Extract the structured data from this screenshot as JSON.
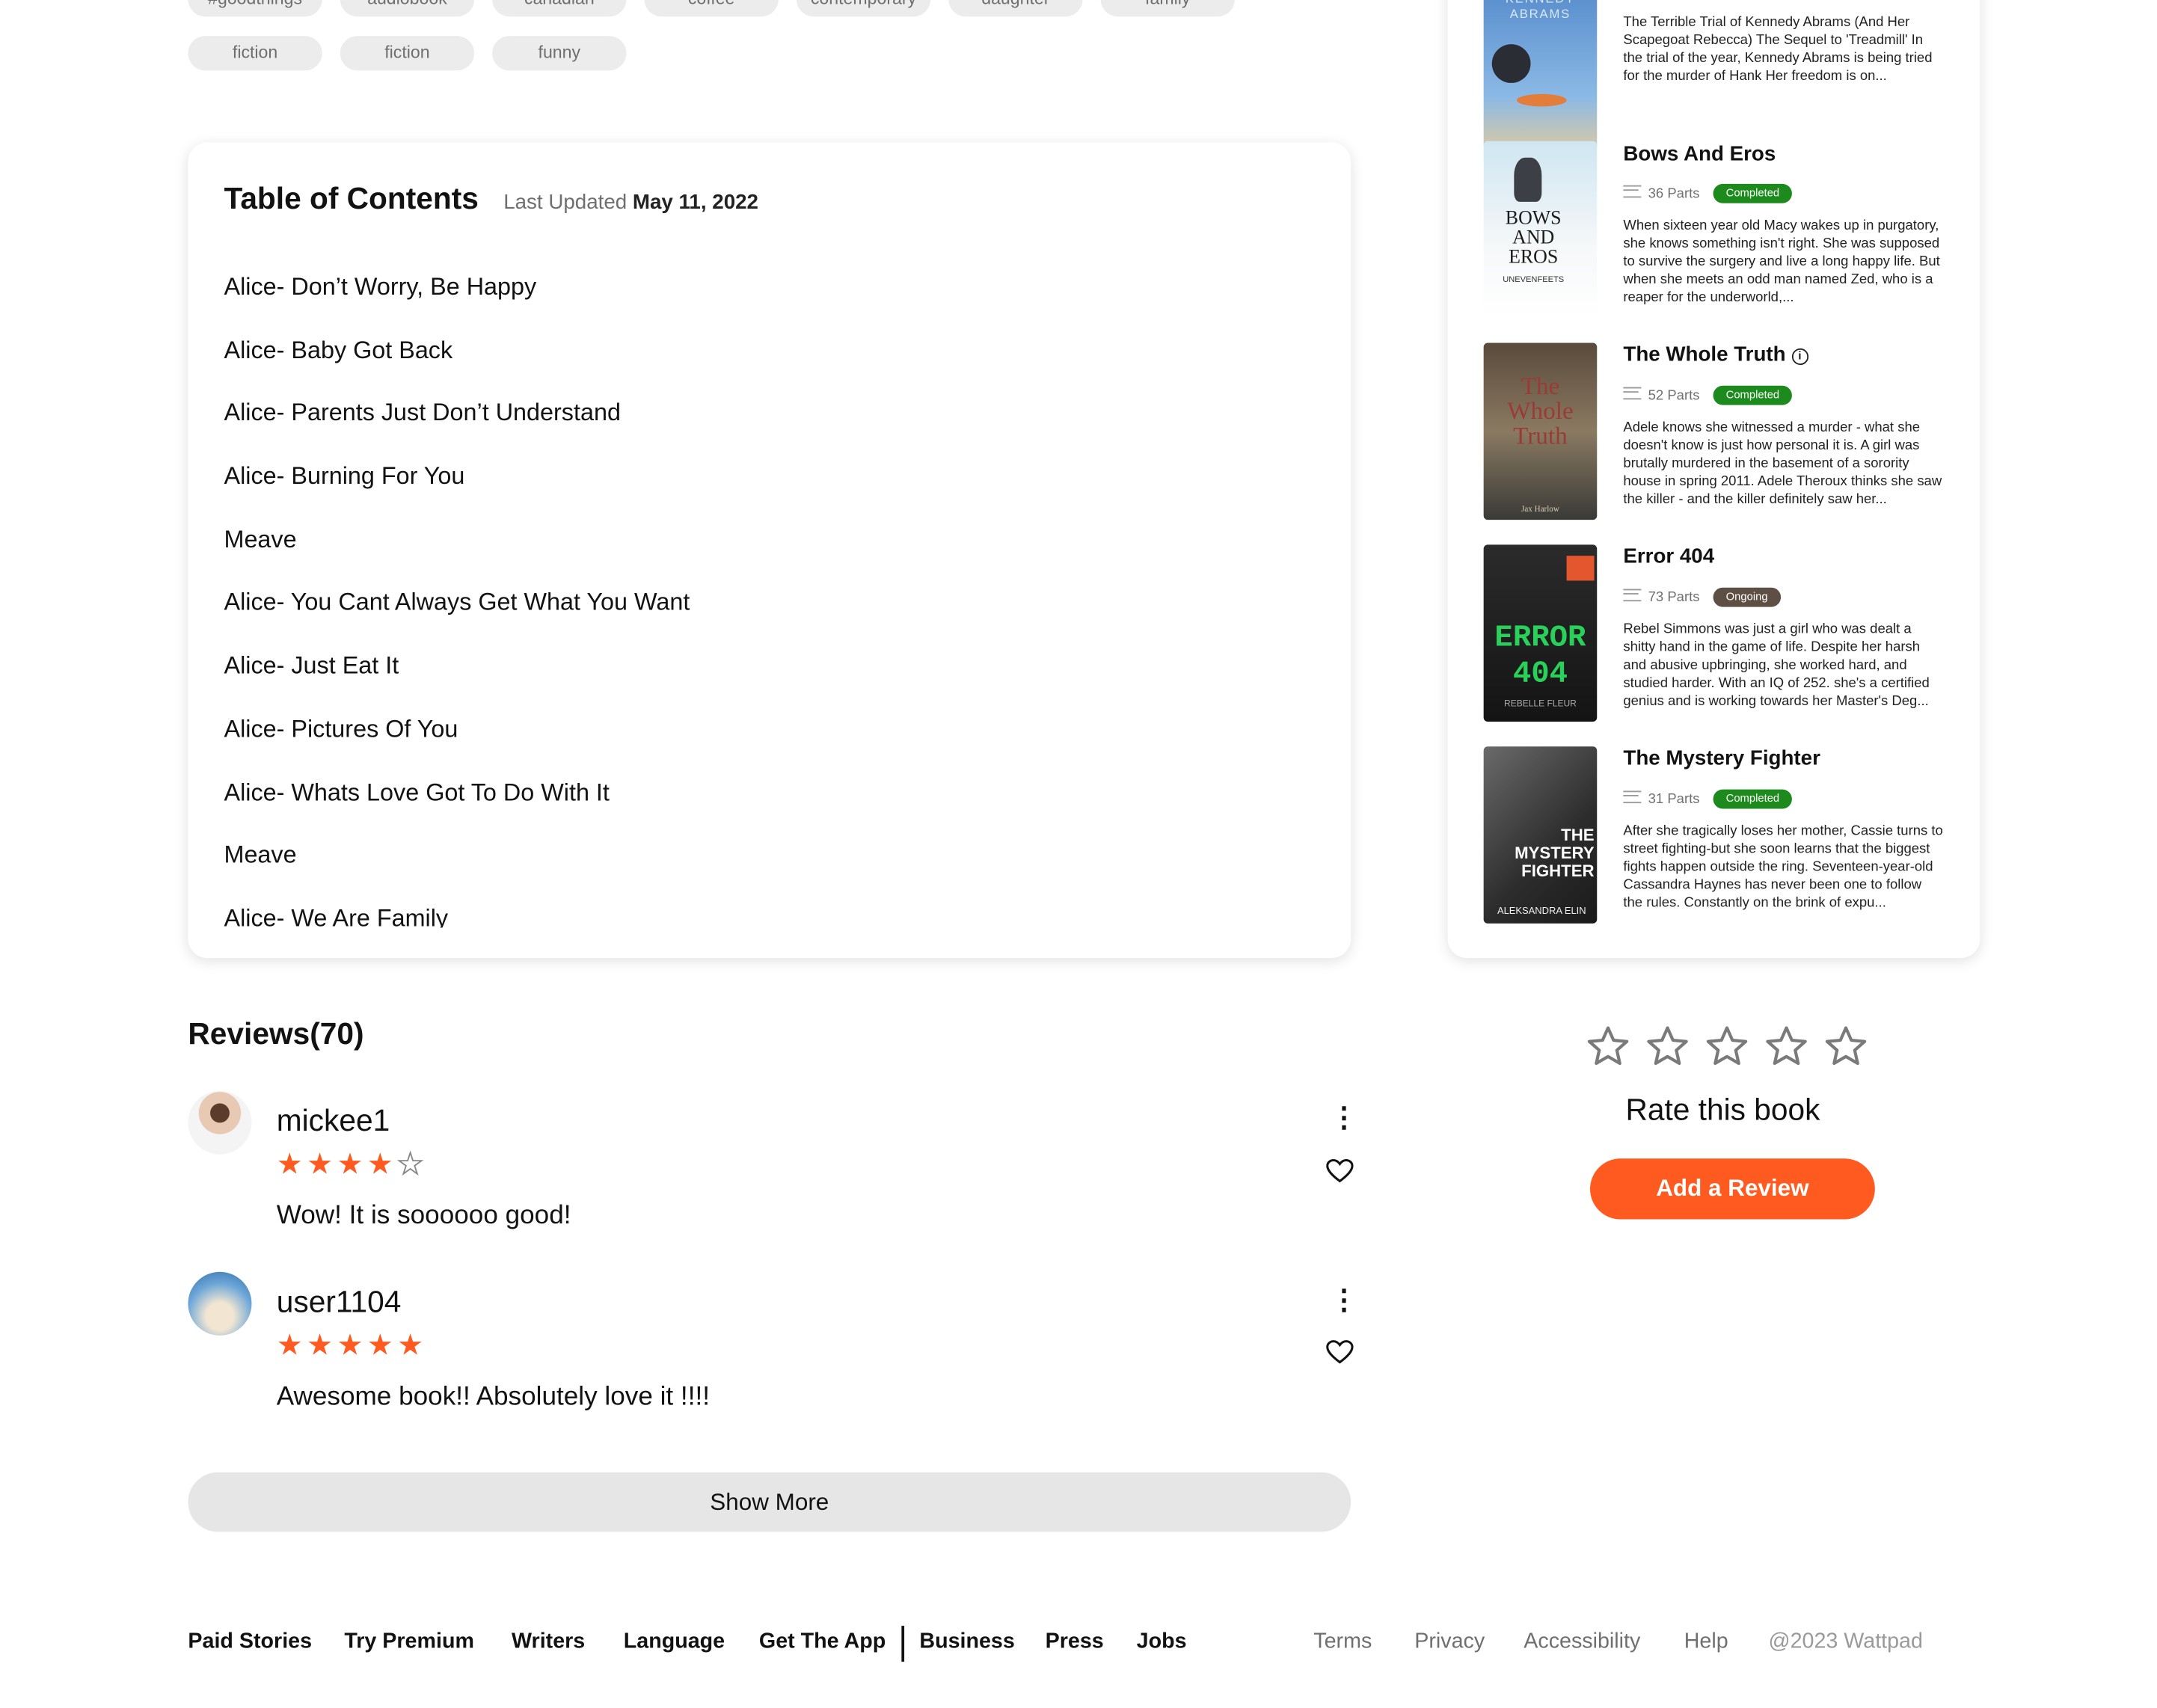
{
  "tags": {
    "row1": [
      "#goodthings",
      "audiobook",
      "canadian",
      "coffee",
      "contemporary",
      "daughter",
      "family"
    ],
    "row2": [
      "fiction",
      "fiction",
      "funny"
    ]
  },
  "toc": {
    "title": "Table of Contents",
    "last_updated_label": "Last Updated",
    "last_updated_date": "May 11, 2022",
    "chapters": [
      "Alice- Don’t Worry, Be Happy",
      "Alice- Baby Got Back",
      "Alice- Parents Just Don’t Understand",
      "Alice- Burning For You",
      "Meave",
      "Alice- You Cant Always Get What You Want",
      "Alice- Just Eat It",
      "Alice- Pictures Of You",
      "Alice- Whats Love Got To Do With It",
      "Meave",
      "Alice- We Are Family"
    ]
  },
  "recommendations": [
    {
      "cover_text": "KENNEDY ABRAMS",
      "description": "The Terrible Trial of Kennedy Abrams (And Her Scapegoat Rebecca) The Sequel to 'Treadmill' In the trial of the year, Kennedy Abrams is being tried for the murder of Hank Her freedom is on..."
    },
    {
      "title": "Bows And Eros",
      "parts": "36 Parts",
      "status": "Completed",
      "cover_text": "BOWS AND EROS",
      "cover_author": "UNEVENFEETS",
      "description": "When sixteen year old Macy wakes up in purgatory, she knows something isn't right. She was supposed to survive the surgery and live a long happy life. But when she meets an odd man named Zed, who is a reaper for the underworld,..."
    },
    {
      "title": "The Whole Truth",
      "parts": "52 Parts",
      "status": "Completed",
      "cover_text": "The Whole Truth",
      "cover_author": "Jax Harlow",
      "description": "Adele knows she witnessed a murder - what she doesn't know is just how personal it is. A girl was brutally murdered in the basement of a sorority house in spring 2011. Adele Theroux thinks she saw the killer - and the killer definitely saw her..."
    },
    {
      "title": "Error 404",
      "parts": "73 Parts",
      "status": "Ongoing",
      "cover_text": "ERROR 404",
      "cover_author": "REBELLE FLEUR",
      "description": "Rebel Simmons was just a girl who was dealt a shitty hand in the game of life. Despite her harsh and abusive upbringing, she worked hard, and studied harder. With an IQ of 252. she's a certified genius and is working towards her Master's Deg..."
    },
    {
      "title": "The Mystery Fighter",
      "parts": "31 Parts",
      "status": "Completed",
      "cover_text": "THE MYSTERY FIGHTER",
      "cover_author": "ALEKSANDRA ELIN",
      "description": "After she tragically loses her mother, Cassie turns to street fighting-but she soon learns that the biggest fights happen outside the ring. Seventeen-year-old Cassandra Haynes has never been one to follow the rules. Constantly on the brink of expu..."
    }
  ],
  "reviews": {
    "title": "Reviews(70)",
    "items": [
      {
        "user": "mickee1",
        "rating": 4,
        "text": "Wow! It is soooooo good!"
      },
      {
        "user": "user1104",
        "rating": 5,
        "text": "Awesome book!! Absolutely love it !!!!"
      }
    ],
    "show_more_label": "Show More"
  },
  "rate": {
    "label": "Rate this book",
    "current_rating": 0,
    "add_review_label": "Add a Review"
  },
  "footer": {
    "links": [
      "Paid Stories",
      "Try Premium",
      "Writers",
      "Language",
      "Get The App",
      "Business",
      "Press",
      "Jobs"
    ],
    "secondary_links": [
      "Terms",
      "Privacy",
      "Accessibility",
      "Help"
    ],
    "copyright": "@2023 Wattpad"
  },
  "colors": {
    "accent": "#ff5a1f",
    "completed_badge": "#1d8a1d",
    "ongoing_badge": "#5e4f44",
    "tag_bg": "#ececec"
  },
  "icons": [
    "kebab-menu-icon",
    "heart-icon",
    "star-icon",
    "parts-list-icon",
    "info-icon"
  ]
}
